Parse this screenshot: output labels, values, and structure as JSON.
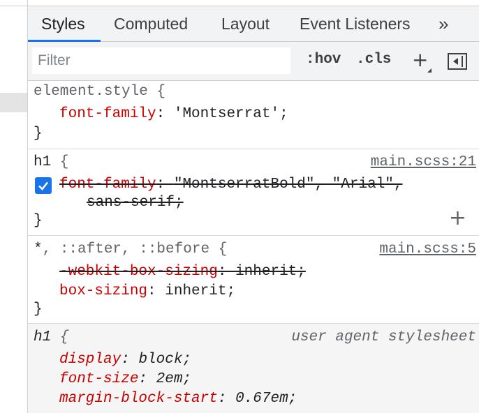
{
  "tabs": [
    {
      "label": "Styles",
      "active": true
    },
    {
      "label": "Computed",
      "active": false
    },
    {
      "label": "Layout",
      "active": false
    },
    {
      "label": "Event Listeners",
      "active": false
    }
  ],
  "tab_more_label": "»",
  "toolbar": {
    "filter_placeholder": "Filter",
    "hov_label": ":hov",
    "cls_label": ".cls",
    "new_rule_icon": "plus-icon",
    "sidebar_toggle_icon": "toggle-sidebar-icon"
  },
  "rules": {
    "element_style": {
      "selector": "element.style",
      "open": " {",
      "property": "font-family",
      "value": "'Montserrat'",
      "close": "}"
    },
    "h1_author": {
      "selector": "h1",
      "open": " {",
      "source": "main.scss:21",
      "property": "font-family",
      "value_line1": "\"MontserratBold\", \"Arial\",",
      "value_line2": "sans-serif",
      "checkbox_checked": true,
      "close": "}"
    },
    "universal": {
      "selector_star": "*",
      "selector_rest": ", ::after, ::before",
      "open": " {",
      "source": "main.scss:5",
      "decl1_property": "-webkit-box-sizing",
      "decl1_value": "inherit",
      "decl2_property": "box-sizing",
      "decl2_value": "inherit",
      "close": "}"
    },
    "user_agent": {
      "selector": "h1",
      "open": " {",
      "source": "user agent stylesheet",
      "decl1_property": "display",
      "decl1_value": "block",
      "decl2_property": "font-size",
      "decl2_value": "2em",
      "decl3_property": "margin-block-start",
      "decl3_value": "0.67em"
    }
  },
  "colors": {
    "accent": "#1a73e8",
    "property": "#c80000",
    "toolbar_bg": "#f1f3f4"
  }
}
